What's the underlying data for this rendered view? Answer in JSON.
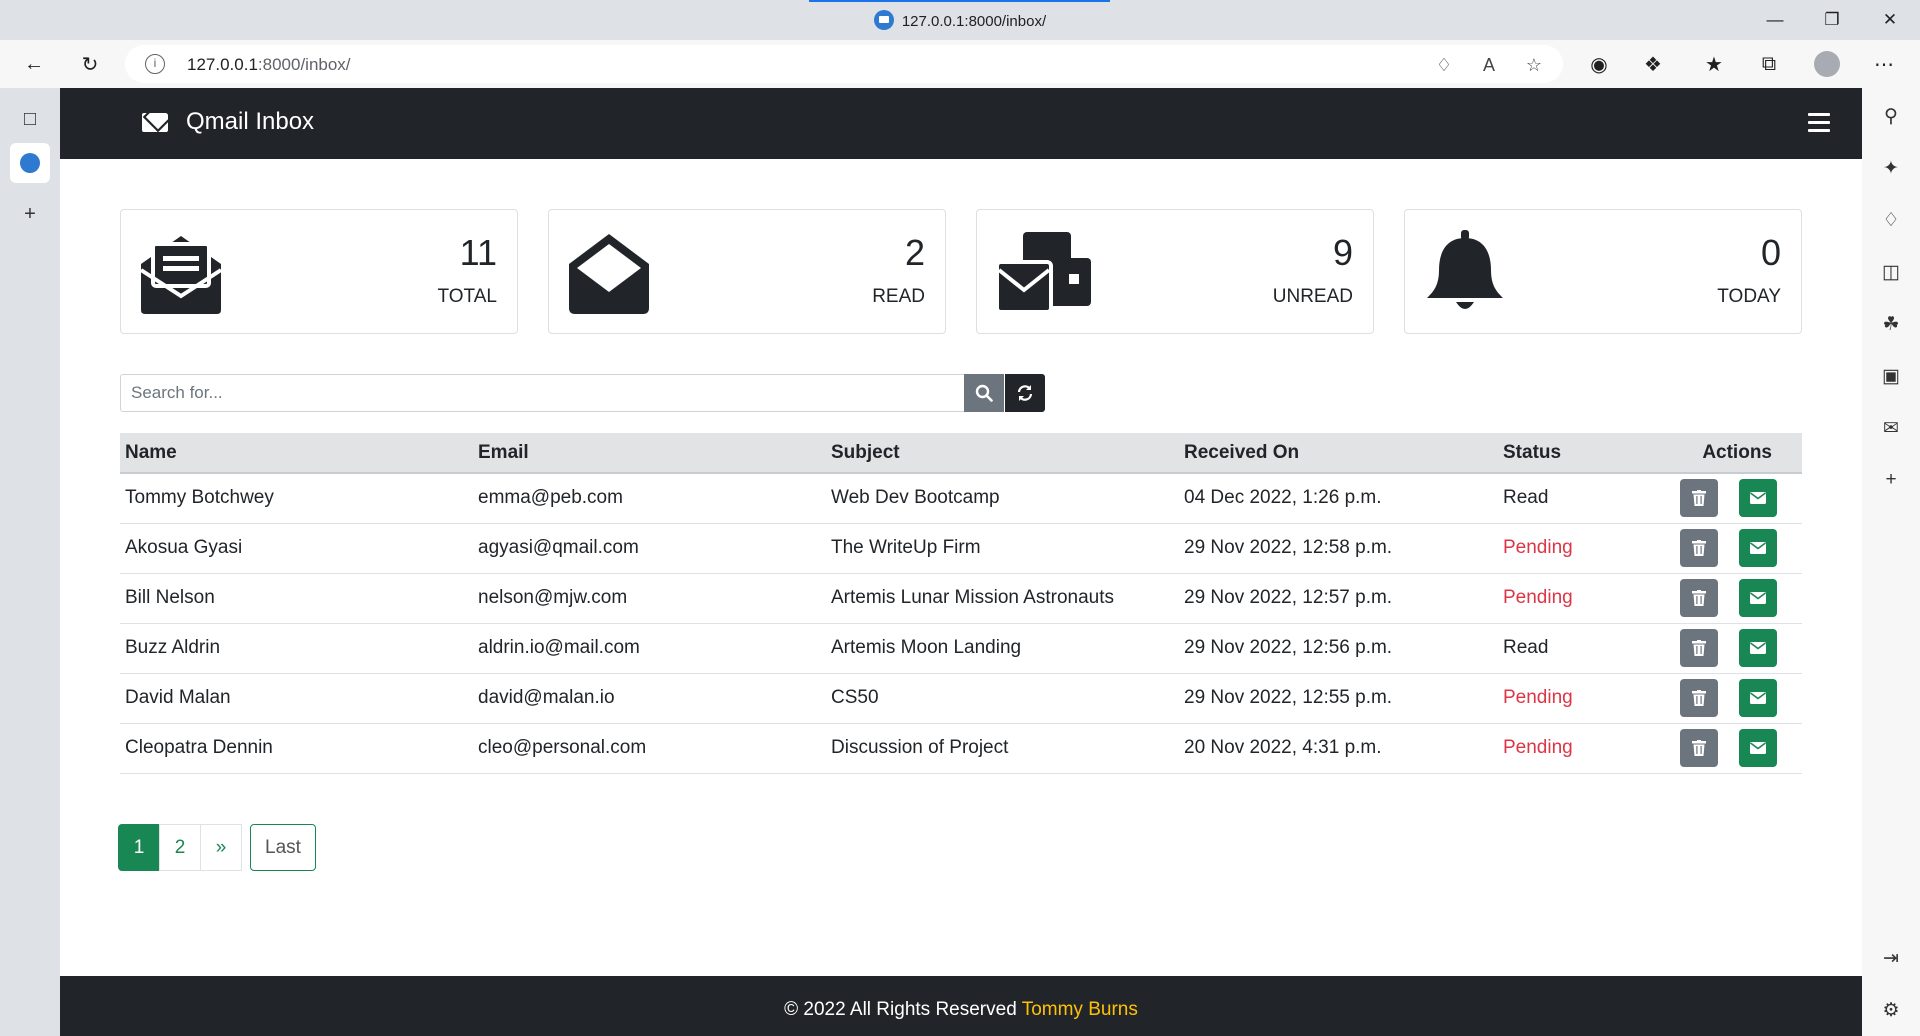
{
  "browser": {
    "tab_title": "127.0.0.1:8000/inbox/",
    "url_host": "127.0.0.1",
    "url_rest": ":8000/inbox/"
  },
  "navbar": {
    "brand": "Qmail Inbox"
  },
  "stats": [
    {
      "value": "11",
      "label": "TOTAL",
      "icon": "envelope-open-text-icon"
    },
    {
      "value": "2",
      "label": "READ",
      "icon": "envelope-open-icon"
    },
    {
      "value": "9",
      "label": "UNREAD",
      "icon": "envelopes-bulk-icon"
    },
    {
      "value": "0",
      "label": "TODAY",
      "icon": "bell-icon"
    }
  ],
  "search": {
    "placeholder": "Search for..."
  },
  "table": {
    "headers": [
      "Name",
      "Email",
      "Subject",
      "Received On",
      "Status",
      "Actions"
    ],
    "rows": [
      {
        "name": "Tommy Botchwey",
        "email": "emma@peb.com",
        "subject": "Web Dev Bootcamp",
        "received": "04 Dec 2022, 1:26 p.m.",
        "status": "Read"
      },
      {
        "name": "Akosua Gyasi",
        "email": "agyasi@qmail.com",
        "subject": "The WriteUp Firm",
        "received": "29 Nov 2022, 12:58 p.m.",
        "status": "Pending"
      },
      {
        "name": "Bill Nelson",
        "email": "nelson@mjw.com",
        "subject": "Artemis Lunar Mission Astronauts",
        "received": "29 Nov 2022, 12:57 p.m.",
        "status": "Pending"
      },
      {
        "name": "Buzz Aldrin",
        "email": "aldrin.io@mail.com",
        "subject": "Artemis Moon Landing",
        "received": "29 Nov 2022, 12:56 p.m.",
        "status": "Read"
      },
      {
        "name": "David Malan",
        "email": "david@malan.io",
        "subject": "CS50",
        "received": "29 Nov 2022, 12:55 p.m.",
        "status": "Pending"
      },
      {
        "name": "Cleopatra Dennin",
        "email": "cleo@personal.com",
        "subject": "Discussion of Project",
        "received": "20 Nov 2022, 4:31 p.m.",
        "status": "Pending"
      }
    ]
  },
  "pagination": {
    "pages": [
      "1",
      "2"
    ],
    "next": "»",
    "last": "Last"
  },
  "footer": {
    "text": "© 2022 All Rights Reserved",
    "author": "Tommy Burns"
  },
  "colors": {
    "navbar": "#212529",
    "success": "#198754",
    "danger": "#dc3545",
    "secondary": "#6c757d",
    "author": "#ffc107"
  }
}
